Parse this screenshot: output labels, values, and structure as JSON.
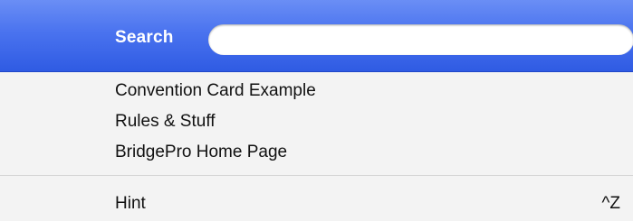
{
  "menu": {
    "search": {
      "label": "Search",
      "value": "",
      "placeholder": ""
    },
    "items": [
      {
        "label": "Convention Card Example"
      },
      {
        "label": "Rules & Stuff"
      },
      {
        "label": "BridgePro Home Page"
      }
    ],
    "hint": {
      "label": "Hint",
      "shortcut": "^Z"
    }
  },
  "colors": {
    "accent_top": "#6a8ef5",
    "accent_bottom": "#2f5be3",
    "menu_background": "#f3f3f3",
    "separator": "#d4d4d4"
  }
}
